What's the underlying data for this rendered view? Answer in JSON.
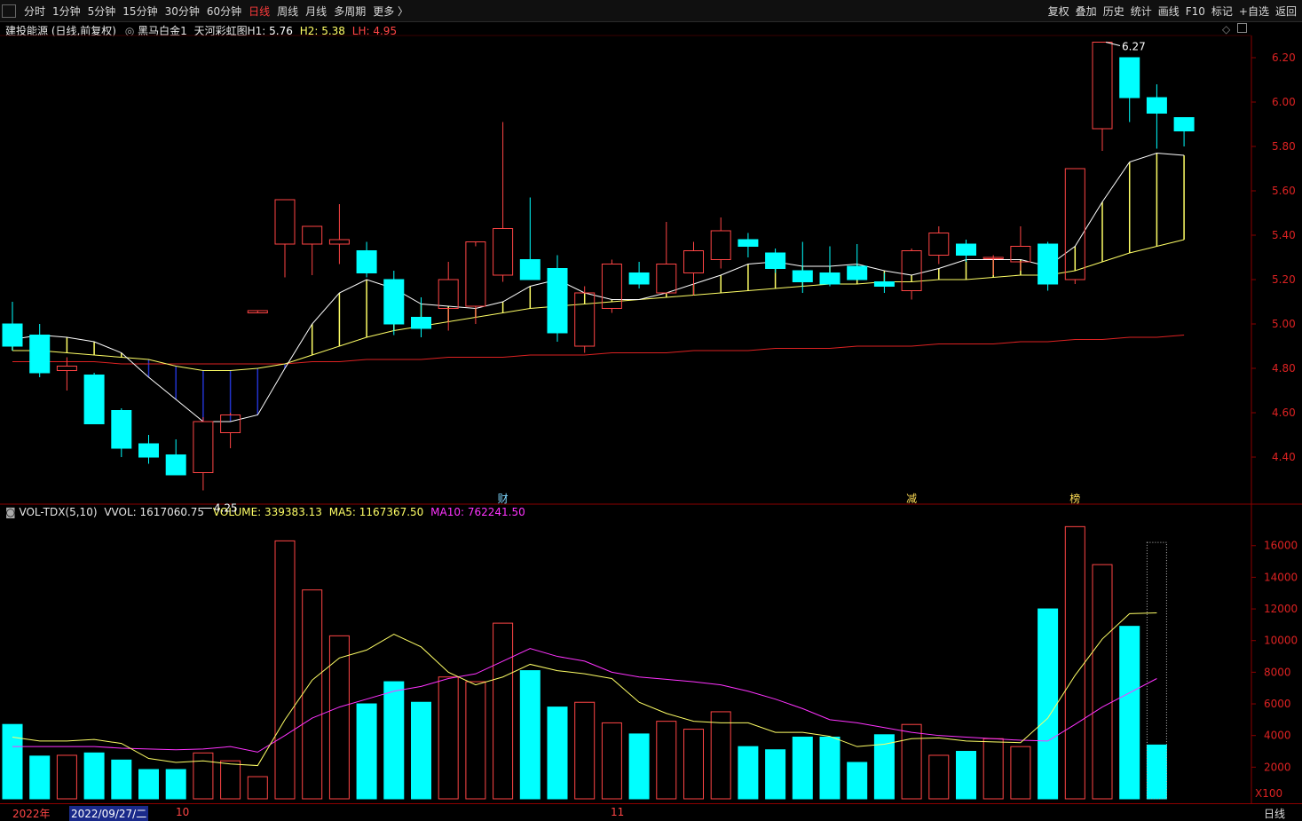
{
  "toolbar": {
    "periods": [
      "分时",
      "1分钟",
      "5分钟",
      "15分钟",
      "30分钟",
      "60分钟",
      "日线",
      "周线",
      "月线",
      "多周期",
      "更多 〉"
    ],
    "active_period": "日线",
    "actions": [
      "复权",
      "叠加",
      "历史",
      "统计",
      "画线",
      "F10",
      "标记",
      "+自选",
      "返回"
    ]
  },
  "price_panel": {
    "stock": "建投能源 (日线,前复权)",
    "indicator_name": "黑马白金1",
    "indicator2": "天河彩虹图H1:",
    "h1": "5.76",
    "h2_label": "H2:",
    "h2": "5.38",
    "lh_label": "LH:",
    "lh": "4.95",
    "high_label": "6.27",
    "low_label": "4.25",
    "markers": [
      "财",
      "减",
      "榜"
    ]
  },
  "volume_panel": {
    "name": "VOL-TDX(5,10)",
    "vvol": "VVOL: 1617060.75",
    "volume": "VOLUME: 339383.13",
    "ma5": "MA5: 1167367.50",
    "ma10": "MA10: 762241.50",
    "multiplier": "X100"
  },
  "axis": {
    "price_ticks": [
      "6.20",
      "6.00",
      "5.80",
      "5.60",
      "5.40",
      "5.20",
      "5.00",
      "4.80",
      "4.60",
      "4.40"
    ],
    "volume_ticks": [
      "16000",
      "14000",
      "12000",
      "10000",
      "8000",
      "6000",
      "4000",
      "2000"
    ]
  },
  "bottom": {
    "year": "2022年",
    "cursor_date": "2022/09/27/二",
    "m10": "10",
    "m11": "11",
    "period": "日线"
  },
  "colors": {
    "up": "#ff4545",
    "down": "#00ffff",
    "ma_white": "#ffffff",
    "ma_yellow": "#ffff66",
    "ma_red": "#dd2222",
    "magenta": "#ff33ff",
    "blue": "#2233cc"
  },
  "chart_data": {
    "type": "candlestick",
    "price_ylim": [
      4.2,
      6.3
    ],
    "volume_ylim": [
      0,
      17500
    ],
    "candles": [
      {
        "o": 5.0,
        "h": 5.1,
        "l": 4.88,
        "c": 4.9
      },
      {
        "o": 4.95,
        "h": 5.0,
        "l": 4.76,
        "c": 4.78
      },
      {
        "o": 4.79,
        "h": 4.85,
        "l": 4.7,
        "c": 4.81
      },
      {
        "o": 4.77,
        "h": 4.78,
        "l": 4.55,
        "c": 4.55
      },
      {
        "o": 4.61,
        "h": 4.62,
        "l": 4.4,
        "c": 4.44
      },
      {
        "o": 4.46,
        "h": 4.5,
        "l": 4.37,
        "c": 4.4
      },
      {
        "o": 4.41,
        "h": 4.48,
        "l": 4.32,
        "c": 4.32
      },
      {
        "o": 4.33,
        "h": 4.58,
        "l": 4.25,
        "c": 4.56
      },
      {
        "o": 4.51,
        "h": 4.6,
        "l": 4.44,
        "c": 4.59
      },
      {
        "o": 5.05,
        "h": 5.05,
        "l": 5.05,
        "c": 5.06
      },
      {
        "o": 5.36,
        "h": 5.56,
        "l": 5.21,
        "c": 5.56
      },
      {
        "o": 5.36,
        "h": 5.44,
        "l": 5.22,
        "c": 5.44
      },
      {
        "o": 5.36,
        "h": 5.54,
        "l": 5.27,
        "c": 5.38
      },
      {
        "o": 5.33,
        "h": 5.37,
        "l": 5.21,
        "c": 5.23
      },
      {
        "o": 5.2,
        "h": 5.24,
        "l": 4.95,
        "c": 5.0
      },
      {
        "o": 5.03,
        "h": 5.12,
        "l": 4.94,
        "c": 4.98
      },
      {
        "o": 5.07,
        "h": 5.28,
        "l": 4.97,
        "c": 5.2
      },
      {
        "o": 5.08,
        "h": 5.35,
        "l": 5.0,
        "c": 5.37
      },
      {
        "o": 5.22,
        "h": 5.91,
        "l": 5.19,
        "c": 5.43
      },
      {
        "o": 5.29,
        "h": 5.57,
        "l": 5.21,
        "c": 5.2
      },
      {
        "o": 5.25,
        "h": 5.31,
        "l": 4.92,
        "c": 4.96
      },
      {
        "o": 4.9,
        "h": 5.17,
        "l": 4.87,
        "c": 5.14
      },
      {
        "o": 5.07,
        "h": 5.29,
        "l": 5.05,
        "c": 5.27
      },
      {
        "o": 5.23,
        "h": 5.28,
        "l": 5.16,
        "c": 5.18
      },
      {
        "o": 5.14,
        "h": 5.46,
        "l": 5.14,
        "c": 5.27
      },
      {
        "o": 5.23,
        "h": 5.37,
        "l": 5.13,
        "c": 5.33
      },
      {
        "o": 5.29,
        "h": 5.48,
        "l": 5.25,
        "c": 5.42
      },
      {
        "o": 5.38,
        "h": 5.41,
        "l": 5.3,
        "c": 5.35
      },
      {
        "o": 5.32,
        "h": 5.34,
        "l": 5.23,
        "c": 5.25
      },
      {
        "o": 5.24,
        "h": 5.37,
        "l": 5.14,
        "c": 5.19
      },
      {
        "o": 5.23,
        "h": 5.35,
        "l": 5.17,
        "c": 5.18
      },
      {
        "o": 5.26,
        "h": 5.36,
        "l": 5.2,
        "c": 5.2
      },
      {
        "o": 5.19,
        "h": 5.23,
        "l": 5.14,
        "c": 5.17
      },
      {
        "o": 5.15,
        "h": 5.34,
        "l": 5.11,
        "c": 5.33
      },
      {
        "o": 5.31,
        "h": 5.44,
        "l": 5.27,
        "c": 5.41
      },
      {
        "o": 5.36,
        "h": 5.38,
        "l": 5.28,
        "c": 5.31
      },
      {
        "o": 5.3,
        "h": 5.31,
        "l": 5.22,
        "c": 5.3
      },
      {
        "o": 5.28,
        "h": 5.44,
        "l": 5.24,
        "c": 5.35
      },
      {
        "o": 5.36,
        "h": 5.37,
        "l": 5.15,
        "c": 5.18
      },
      {
        "o": 5.2,
        "h": 5.7,
        "l": 5.18,
        "c": 5.7
      },
      {
        "o": 5.88,
        "h": 6.27,
        "l": 5.78,
        "c": 6.27
      },
      {
        "o": 6.2,
        "h": 6.2,
        "l": 5.91,
        "c": 6.02
      },
      {
        "o": 6.02,
        "h": 6.08,
        "l": 5.79,
        "c": 5.95
      },
      {
        "o": 5.93,
        "h": 5.93,
        "l": 5.8,
        "c": 5.87
      }
    ],
    "volume": [
      4700,
      2700,
      2750,
      2900,
      2450,
      1850,
      1850,
      2900,
      2400,
      1400,
      16300,
      13200,
      10300,
      6000,
      7400,
      6100,
      7700,
      7400,
      11100,
      8100,
      5800,
      6100,
      4800,
      4100,
      4900,
      4400,
      5500,
      3300,
      3100,
      3900,
      3900,
      2300,
      4050,
      4700,
      2750,
      3000,
      3800,
      3300,
      12000,
      17200,
      14800,
      10900,
      3400
    ],
    "volume_ma5": [
      3900,
      3650,
      3650,
      3750,
      3500,
      2550,
      2300,
      2400,
      2200,
      2100,
      5000,
      7500,
      8900,
      9400,
      10400,
      9600,
      8000,
      7200,
      7700,
      8500,
      8100,
      7900,
      7600,
      6100,
      5400,
      4900,
      4800,
      4800,
      4200,
      4200,
      3950,
      3300,
      3450,
      3800,
      3850,
      3650,
      3600,
      3550,
      5100,
      7800,
      10100,
      11700,
      11750
    ],
    "volume_ma10": [
      3300,
      3300,
      3300,
      3300,
      3200,
      3150,
      3100,
      3150,
      3300,
      2950,
      4000,
      5100,
      5800,
      6300,
      6800,
      7100,
      7600,
      7900,
      8700,
      9500,
      9000,
      8700,
      8000,
      7700,
      7550,
      7400,
      7200,
      6800,
      6300,
      5700,
      5000,
      4800,
      4500,
      4200,
      4000,
      3900,
      3800,
      3700,
      3650,
      4700,
      5800,
      6700,
      7600
    ],
    "ma_white": [
      4.93,
      4.95,
      4.94,
      4.92,
      4.87,
      4.76,
      4.66,
      4.56,
      4.56,
      4.59,
      4.8,
      5.0,
      5.14,
      5.2,
      5.16,
      5.09,
      5.08,
      5.07,
      5.1,
      5.17,
      5.2,
      5.14,
      5.11,
      5.11,
      5.14,
      5.18,
      5.22,
      5.27,
      5.28,
      5.26,
      5.26,
      5.27,
      5.24,
      5.22,
      5.25,
      5.29,
      5.29,
      5.29,
      5.26,
      5.35,
      5.55,
      5.73,
      5.77,
      5.76
    ],
    "ma_yellow": [
      4.88,
      4.88,
      4.87,
      4.86,
      4.85,
      4.84,
      4.81,
      4.79,
      4.79,
      4.8,
      4.82,
      4.86,
      4.9,
      4.94,
      4.97,
      4.99,
      5.01,
      5.03,
      5.05,
      5.07,
      5.08,
      5.09,
      5.1,
      5.11,
      5.12,
      5.13,
      5.14,
      5.15,
      5.16,
      5.17,
      5.18,
      5.18,
      5.19,
      5.19,
      5.2,
      5.2,
      5.21,
      5.22,
      5.22,
      5.24,
      5.28,
      5.32,
      5.35,
      5.38
    ],
    "ma_red": [
      4.83,
      4.83,
      4.83,
      4.83,
      4.82,
      4.82,
      4.82,
      4.82,
      4.82,
      4.82,
      4.82,
      4.83,
      4.83,
      4.84,
      4.84,
      4.84,
      4.85,
      4.85,
      4.85,
      4.86,
      4.86,
      4.86,
      4.87,
      4.87,
      4.87,
      4.88,
      4.88,
      4.88,
      4.89,
      4.89,
      4.89,
      4.9,
      4.9,
      4.9,
      4.91,
      4.91,
      4.91,
      4.92,
      4.92,
      4.93,
      4.93,
      4.94,
      4.94,
      4.95
    ]
  }
}
